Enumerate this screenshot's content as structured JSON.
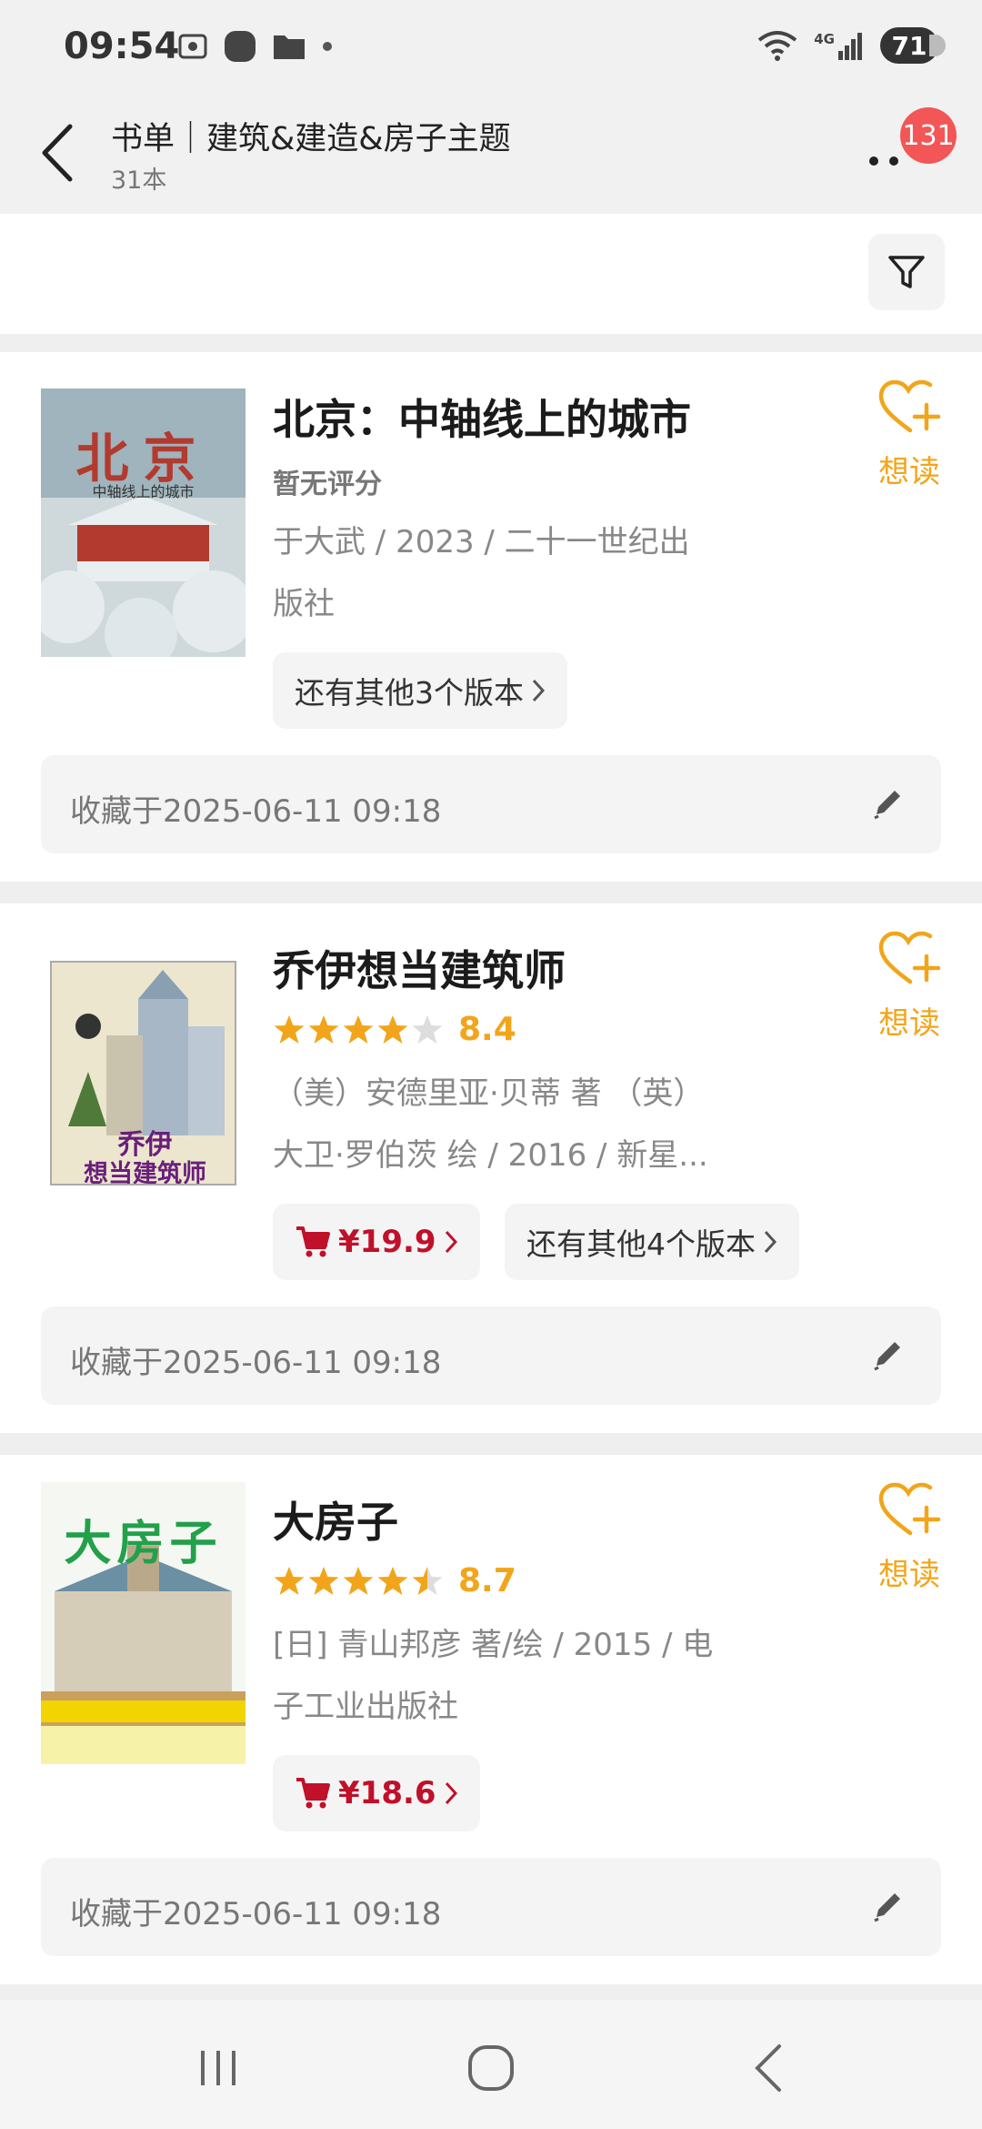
{
  "status_bar": {
    "time": "09:54",
    "network": "4G",
    "battery": "71",
    "icons": [
      "screenshot-icon",
      "app-icon",
      "folder-icon",
      "dot-icon",
      "wifi-icon",
      "signal-icon",
      "battery-icon"
    ]
  },
  "header": {
    "title": "书单｜建筑&建造&房子主题",
    "subtitle": "31本",
    "badge_count": "131"
  },
  "colors": {
    "accent_orange": "#f2a51a",
    "price_red": "#c0102a",
    "badge_red": "#f25656"
  },
  "books": [
    {
      "title": "北京：中轴线上的城市",
      "rating_text": "暂无评分",
      "rating": null,
      "meta_line1": "于大武 / 2023 / 二十一世纪出",
      "meta_line2": "版社",
      "price": null,
      "versions": "还有其他3个版本",
      "want_label": "想读",
      "collected": "收藏于2025-06-11 09:18",
      "cover_title": "北京",
      "cover_subtitle": "中轴线上的城市"
    },
    {
      "title": "乔伊想当建筑师",
      "rating_text": "",
      "rating": 4,
      "score": "8.4",
      "meta_line1": "（美）安德里亚·贝蒂 著 （英）",
      "meta_line2": "大卫·罗伯茨 绘 / 2016 / 新星...",
      "price": "¥19.9",
      "versions": "还有其他4个版本",
      "want_label": "想读",
      "collected": "收藏于2025-06-11 09:18",
      "cover_title": "乔伊",
      "cover_subtitle": "想当建筑师"
    },
    {
      "title": "大房子",
      "rating_text": "",
      "rating": 4.5,
      "score": "8.7",
      "meta_line1": "[日] 青山邦彦 著/绘 / 2015 / 电",
      "meta_line2": "子工业出版社",
      "price": "¥18.6",
      "versions": null,
      "want_label": "想读",
      "collected": "收藏于2025-06-11 09:18",
      "cover_title": "大房子",
      "cover_subtitle": ""
    }
  ],
  "nav": [
    "recents-icon",
    "home-icon",
    "back-icon"
  ]
}
